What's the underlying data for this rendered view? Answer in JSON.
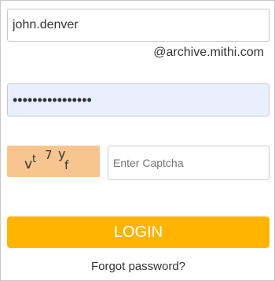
{
  "login_form": {
    "username_value": "john.denver",
    "domain_suffix": "@archive.mithi.com",
    "password_value": "••••••••••••••••",
    "captcha": {
      "text": "vt 7 yf",
      "image_color": "#f8c591",
      "input_placeholder": "Enter Captcha",
      "input_value": ""
    },
    "login_label": "LOGIN",
    "forgot_password_label": "Forgot password?",
    "colors": {
      "accent": "#ffb400",
      "password_fill": "#e8f0fe"
    }
  }
}
